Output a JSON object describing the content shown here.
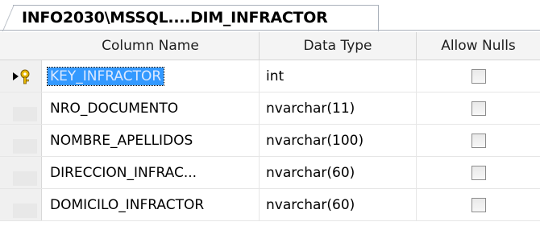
{
  "tab": {
    "title": "INFO2030\\MSSQL....DIM_INFRACTOR"
  },
  "grid": {
    "headers": {
      "column_name": "Column Name",
      "data_type": "Data Type",
      "allow_nulls": "Allow Nulls"
    },
    "rows": [
      {
        "name": "KEY_INFRACTOR",
        "type": "int",
        "allow_nulls": false
      },
      {
        "name": "NRO_DOCUMENTO",
        "type": "nvarchar(11)",
        "allow_nulls": false
      },
      {
        "name": "NOMBRE_APELLIDOS",
        "type": "nvarchar(100)",
        "allow_nulls": false
      },
      {
        "name": "DIRECCION_INFRAC...",
        "type": "nvarchar(60)",
        "allow_nulls": false
      },
      {
        "name": "DOMICILO_INFRACTOR",
        "type": "nvarchar(60)",
        "allow_nulls": false
      }
    ]
  },
  "icons": {
    "current_row_key": "primary-key-arrow-icon"
  },
  "colors": {
    "selection": "#3399ff",
    "key_gold": "#d8a400"
  }
}
